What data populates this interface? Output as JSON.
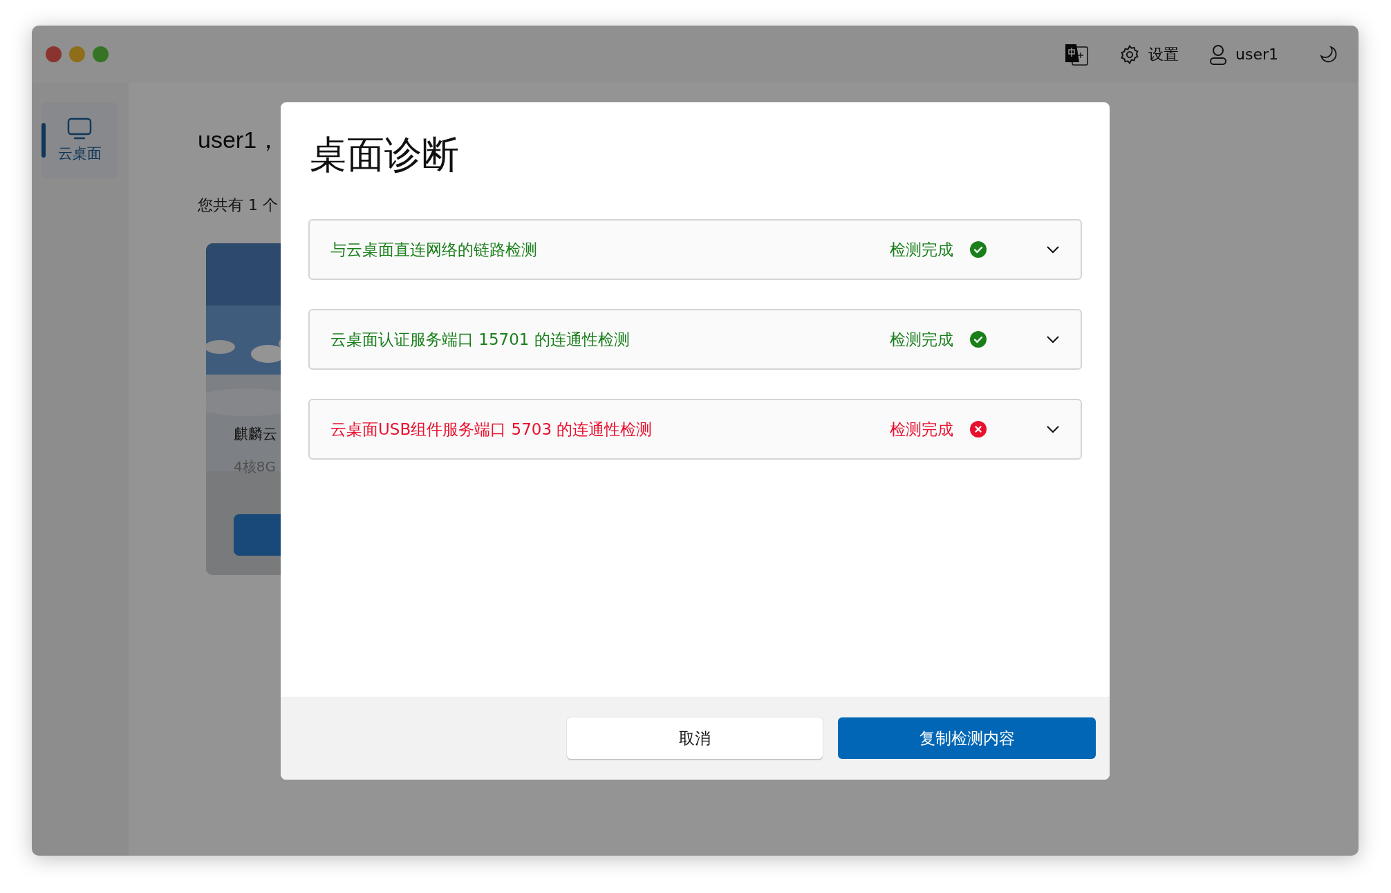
{
  "topbar": {
    "settings_label": "设置",
    "user_name": "user1"
  },
  "sidebar": {
    "items": [
      {
        "label": "云桌面",
        "selected": true
      }
    ]
  },
  "main": {
    "greeting": "user1，",
    "summary": "您共有 1 个",
    "desktop_card": {
      "name": "麒麟云",
      "spec": "4核8G"
    }
  },
  "dialog": {
    "title": "桌面诊断",
    "checks": [
      {
        "label": "与云桌面直连网络的链路检测",
        "status": "检测完成",
        "kind": "pass",
        "expanded": false
      },
      {
        "label": "云桌面认证服务端口 15701 的连通性检测",
        "status": "检测完成",
        "kind": "pass",
        "expanded": false
      },
      {
        "label": "云桌面USB组件服务端口 5703 的连通性检测",
        "status": "检测完成",
        "kind": "fail",
        "expanded": false
      }
    ],
    "buttons": {
      "cancel": "取消",
      "primary": "复制检测内容"
    }
  }
}
